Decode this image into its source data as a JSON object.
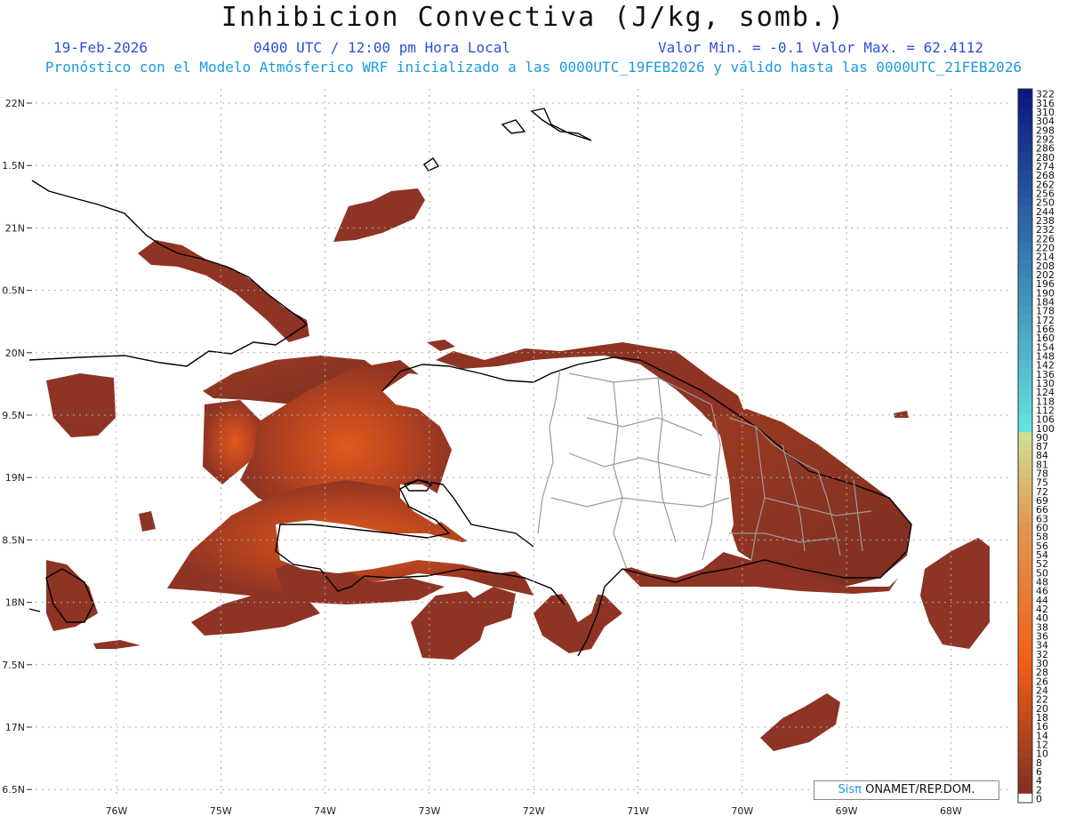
{
  "title": "Inhibicion Convectiva (J/kg, somb.)",
  "header": {
    "date": "19-Feb-2026",
    "time": "0400 UTC / 12:00 pm Hora Local",
    "range": "Valor Min. = -0.1  Valor Max. = 62.4112"
  },
  "subtitle": "Pronóstico con el Modelo Atmósferico WRF inicializado a las 0000UTC_19FEB2026 y válido hasta las  0000UTC_21FEB2026",
  "axes": {
    "lat_labels": [
      "22N",
      "1.5N",
      "21N",
      "0.5N",
      "20N",
      "9.5N",
      "19N",
      "8.5N",
      "18N",
      "7.5N",
      "17N",
      "6.5N"
    ],
    "lon_labels": [
      "76W",
      "75W",
      "74W",
      "73W",
      "72W",
      "71W",
      "70W",
      "69W",
      "68W"
    ]
  },
  "colorbar": {
    "labels": [
      "322",
      "316",
      "310",
      "304",
      "298",
      "292",
      "286",
      "280",
      "274",
      "268",
      "262",
      "256",
      "250",
      "244",
      "238",
      "232",
      "226",
      "220",
      "214",
      "208",
      "202",
      "196",
      "190",
      "184",
      "178",
      "172",
      "166",
      "160",
      "154",
      "148",
      "142",
      "136",
      "130",
      "124",
      "118",
      "112",
      "106",
      "100",
      "90",
      "87",
      "84",
      "81",
      "78",
      "75",
      "72",
      "69",
      "66",
      "63",
      "60",
      "58",
      "56",
      "54",
      "52",
      "50",
      "48",
      "46",
      "44",
      "42",
      "40",
      "38",
      "36",
      "34",
      "32",
      "30",
      "28",
      "26",
      "24",
      "22",
      "20",
      "18",
      "16",
      "14",
      "12",
      "10",
      "8",
      "6",
      "4",
      "2",
      "0"
    ]
  },
  "colors": {
    "field_main": "#8e3424",
    "field_hot": "#d9531c",
    "coast": "#000000",
    "borders": "#9a9a9a",
    "grid": "#aaaaaa"
  },
  "credit": {
    "logo": "Sisπ",
    "text": " ONAMET/REP.DOM."
  }
}
